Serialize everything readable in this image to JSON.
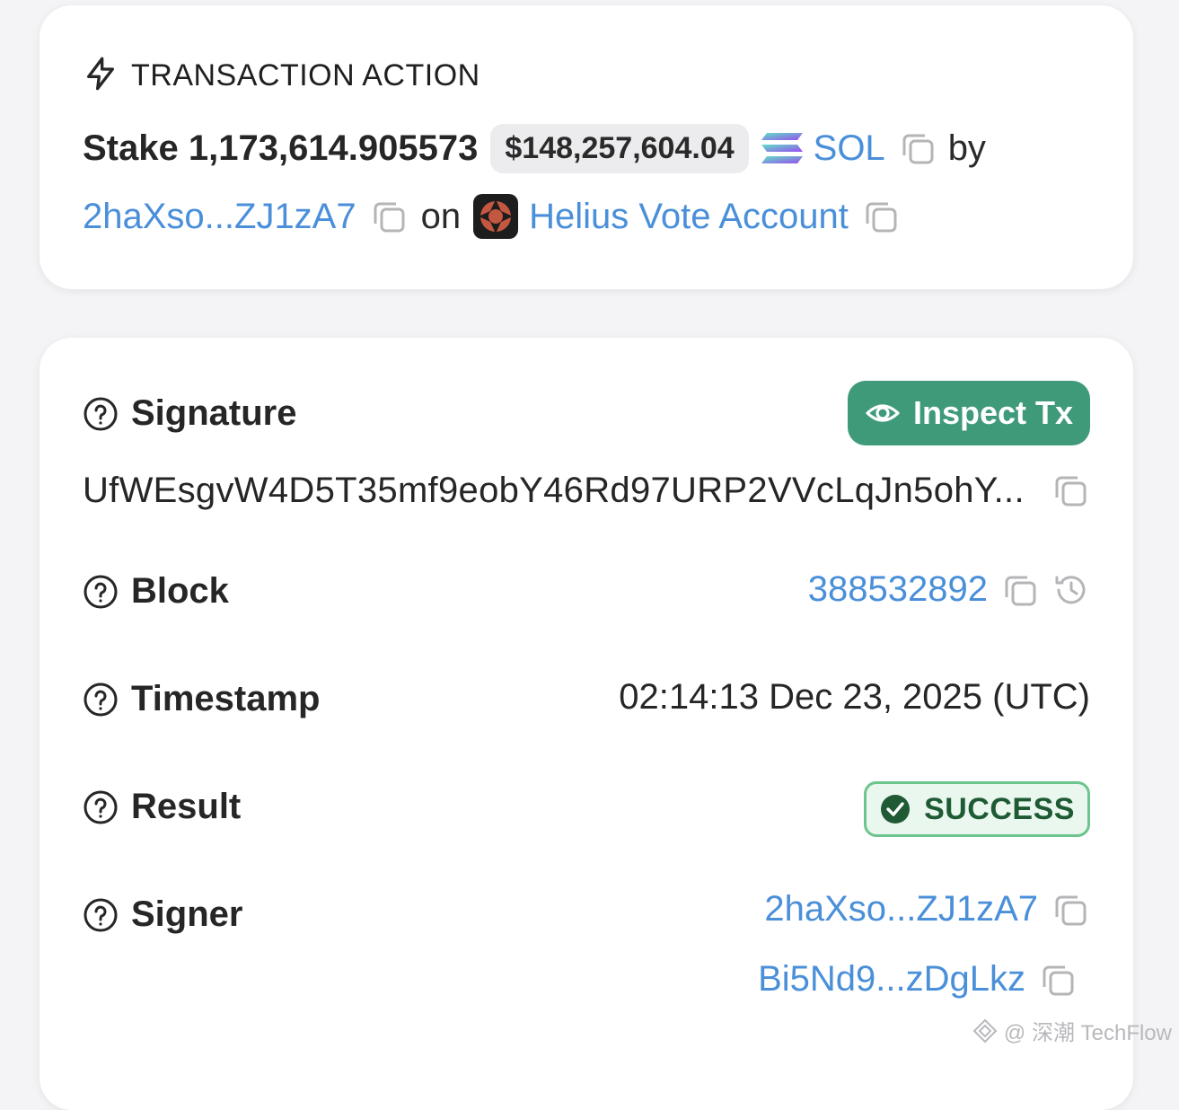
{
  "action": {
    "header": "TRANSACTION ACTION",
    "verb_amount": "Stake 1,173,614.905573",
    "usd_value": "$148,257,604.04",
    "token_symbol": "SOL",
    "by_text": "by",
    "staker": "2haXso...ZJ1zA7",
    "on_text": "on",
    "validator": "Helius Vote Account"
  },
  "details": {
    "inspect_label": "Inspect Tx",
    "signature": {
      "label": "Signature",
      "value": "UfWEsgvW4D5T35mf9eobY46Rd97URP2VVcLqJn5ohY..."
    },
    "block": {
      "label": "Block",
      "value": "388532892"
    },
    "timestamp": {
      "label": "Timestamp",
      "value": "02:14:13 Dec 23, 2025 (UTC)"
    },
    "result": {
      "label": "Result",
      "value": "SUCCESS"
    },
    "signer": {
      "label": "Signer",
      "values": [
        "2haXso...ZJ1zA7",
        "Bi5Nd9...zDgLkz"
      ]
    }
  },
  "watermark": "@ 深潮 TechFlow",
  "colors": {
    "link": "#4a8fd9",
    "inspect_button": "#3f9a7a",
    "success_border": "#6cc58c",
    "success_bg": "#eaf7ef",
    "page_bg": "#f4f4f6"
  },
  "icons": [
    "lightning-icon",
    "solana-logo",
    "copy-icon",
    "helius-logo",
    "question-icon",
    "eye-icon",
    "history-icon",
    "check-circle-icon"
  ]
}
